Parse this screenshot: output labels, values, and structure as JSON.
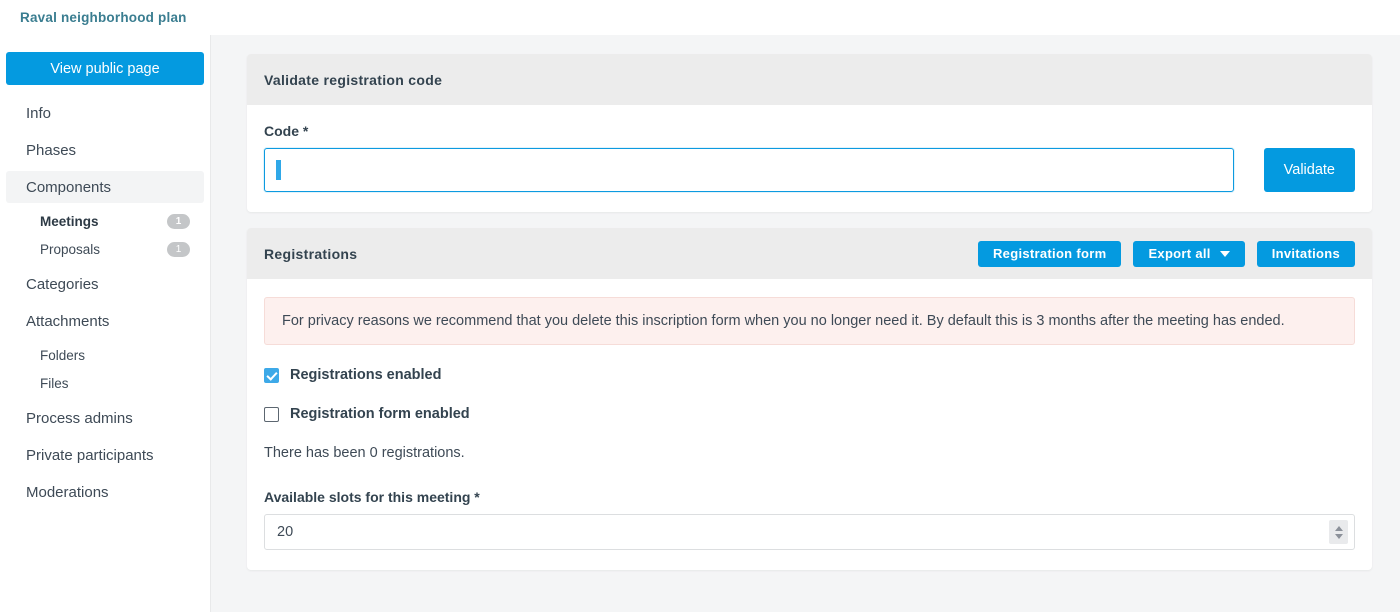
{
  "header": {
    "title": "Raval neighborhood plan",
    "title_color": "#3a7d90"
  },
  "sidebar": {
    "public_page_button": "View public page",
    "items": [
      {
        "label": "Info",
        "badge": null,
        "active": false,
        "sub": false
      },
      {
        "label": "Phases",
        "badge": null,
        "active": false,
        "sub": false
      },
      {
        "label": "Components",
        "badge": null,
        "active": true,
        "sub": false
      },
      {
        "label": "Meetings",
        "badge": "1",
        "active": false,
        "sub": true,
        "bold": true
      },
      {
        "label": "Proposals",
        "badge": "1",
        "active": false,
        "sub": true,
        "bold": false
      },
      {
        "label": "Categories",
        "badge": null,
        "active": false,
        "sub": false
      },
      {
        "label": "Attachments",
        "badge": null,
        "active": false,
        "sub": false
      },
      {
        "label": "Folders",
        "badge": null,
        "active": false,
        "sub": true,
        "bold": false
      },
      {
        "label": "Files",
        "badge": null,
        "active": false,
        "sub": true,
        "bold": false
      },
      {
        "label": "Process admins",
        "badge": null,
        "active": false,
        "sub": false
      },
      {
        "label": "Private participants",
        "badge": null,
        "active": false,
        "sub": false
      },
      {
        "label": "Moderations",
        "badge": null,
        "active": false,
        "sub": false
      }
    ]
  },
  "validate_card": {
    "title": "Validate registration code",
    "code_label": "Code *",
    "code_value": "",
    "code_placeholder": "",
    "validate_button": "Validate"
  },
  "registrations_card": {
    "title": "Registrations",
    "buttons": {
      "registration_form": "Registration form",
      "export_all": "Export all",
      "invitations": "Invitations"
    },
    "privacy_alert": "For privacy reasons we recommend that you delete this inscription form when you no longer need it. By default this is 3 months after the meeting has ended.",
    "registrations_enabled_label": "Registrations enabled",
    "registrations_enabled_checked": true,
    "registration_form_enabled_label": "Registration form enabled",
    "registration_form_enabled_checked": false,
    "registrations_count_text": "There has been 0 registrations.",
    "available_slots_label": "Available slots for this meeting *",
    "available_slots_value": "20"
  },
  "colors": {
    "accent": "#049ae0",
    "alert_bg": "#fdf0ee",
    "alert_border": "#f6dcd8",
    "card_head_bg": "#ececec",
    "page_bg": "#f4f5f6"
  }
}
